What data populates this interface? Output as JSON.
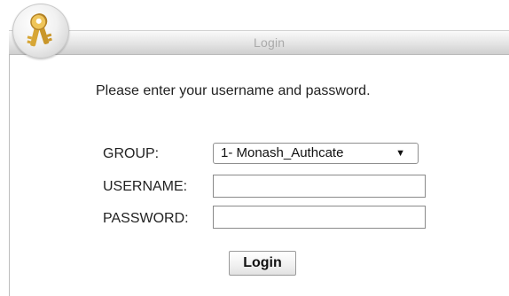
{
  "login_panel": {
    "title": "Login",
    "icon": "keys-icon",
    "prompt": "Please enter your username and password.",
    "group": {
      "label": "GROUP:",
      "selected": "1- Monash_Authcate",
      "arrow": "▼"
    },
    "username": {
      "label": "USERNAME:",
      "value": ""
    },
    "password": {
      "label": "PASSWORD:",
      "value": ""
    },
    "submit_label": "Login"
  },
  "colors": {
    "title_text": "#aaaaaa",
    "title_bar": "#e4e4e4",
    "body_text": "#222222",
    "key_gold": "#d9a93a"
  }
}
